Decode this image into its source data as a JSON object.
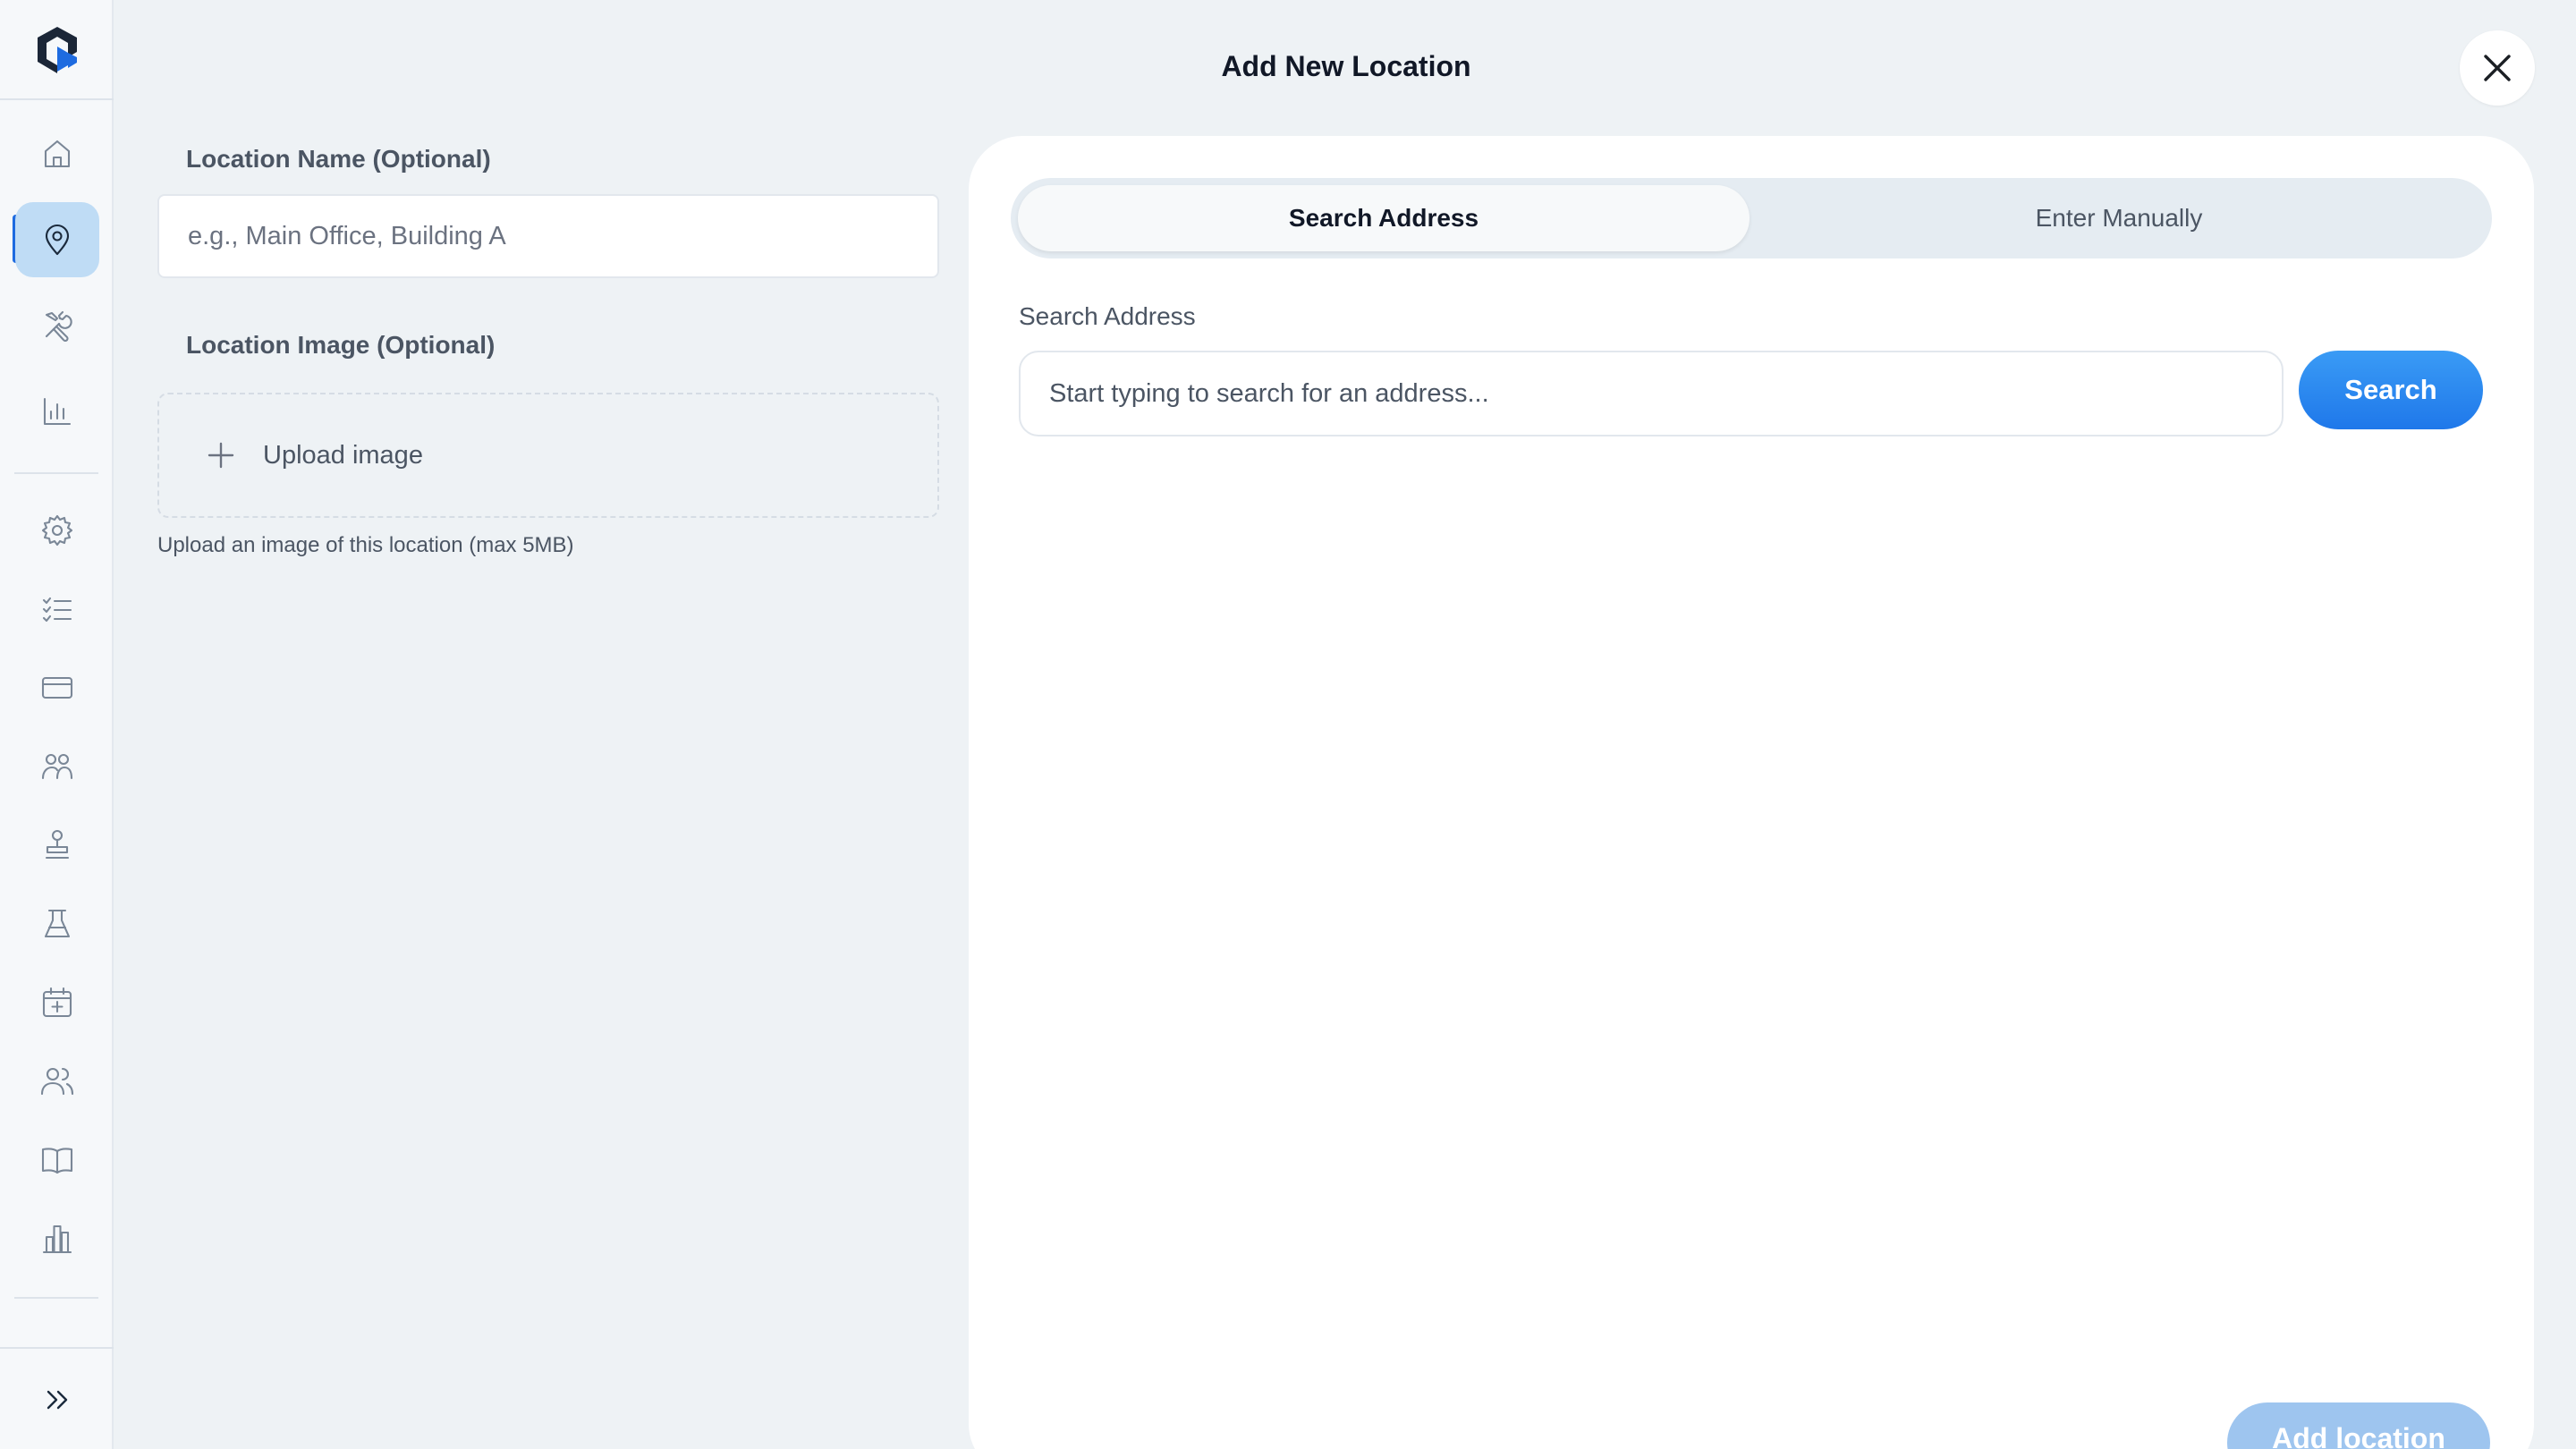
{
  "modal": {
    "title": "Add New Location",
    "close_label": "close"
  },
  "form": {
    "name_label": "Location Name (Optional)",
    "name_placeholder": "e.g., Main Office, Building A",
    "name_value": "",
    "image_label": "Location Image (Optional)",
    "upload_label": "Upload image",
    "upload_hint": "Upload an image of this location (max 5MB)"
  },
  "address": {
    "tabs": [
      {
        "label": "Search Address",
        "selected": true
      },
      {
        "label": "Enter Manually",
        "selected": false
      }
    ],
    "search_label": "Search Address",
    "search_placeholder": "Start typing to search for an address...",
    "search_value": "",
    "search_button": "Search"
  },
  "footer": {
    "add_button": "Add location"
  },
  "sidebar": {
    "items": [
      {
        "icon": "home-icon",
        "active": false
      },
      {
        "icon": "location-pin-icon",
        "active": true
      },
      {
        "icon": "tools-icon",
        "active": false
      },
      {
        "icon": "bar-chart-icon",
        "active": false
      },
      {
        "icon": "gear-icon",
        "active": false
      },
      {
        "icon": "checklist-icon",
        "active": false
      },
      {
        "icon": "credit-card-icon",
        "active": false
      },
      {
        "icon": "team-icon",
        "active": false
      },
      {
        "icon": "stamp-icon",
        "active": false
      },
      {
        "icon": "flask-icon",
        "active": false
      },
      {
        "icon": "calendar-add-icon",
        "active": false
      },
      {
        "icon": "users-icon",
        "active": false
      },
      {
        "icon": "book-icon",
        "active": false
      },
      {
        "icon": "building-chart-icon",
        "active": false
      }
    ]
  },
  "colors": {
    "accent": "#1f78ea",
    "active_nav_bg": "#bfdcf5",
    "background": "#eef2f5",
    "disabled_button": "#9ec5ef"
  }
}
